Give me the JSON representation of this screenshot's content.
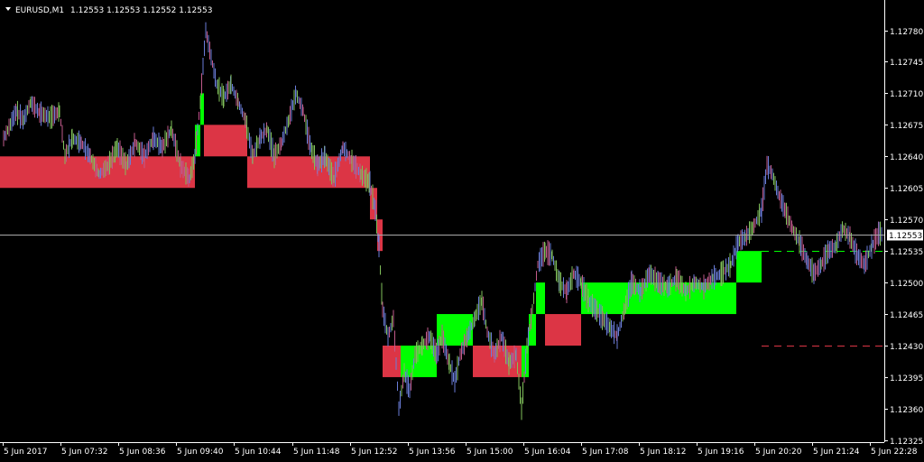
{
  "header": {
    "symbol": "EURUSD,M1",
    "ohlc": "1.12553 1.12553 1.12552 1.12553"
  },
  "colors": {
    "background": "#000000",
    "up_box": "#00ff00",
    "down_box": "#dc3545",
    "price_line": "#a9a9a9",
    "candle_a": "#6a7dd8",
    "candle_b": "#c05a8a",
    "candle_c": "#7fbf5a",
    "axis": "#ffffff"
  },
  "chart_data": {
    "type": "renko_overlay_price_chart",
    "x_tick_labels": [
      "5 Jun 2017",
      "5 Jun 07:32",
      "5 Jun 08:36",
      "5 Jun 09:40",
      "5 Jun 10:44",
      "5 Jun 11:48",
      "5 Jun 12:52",
      "5 Jun 13:56",
      "5 Jun 15:00",
      "5 Jun 16:04",
      "5 Jun 17:08",
      "5 Jun 18:12",
      "5 Jun 19:16",
      "5 Jun 20:20",
      "5 Jun 21:24",
      "5 Jun 22:28"
    ],
    "y_tick_labels": [
      "1.12780",
      "1.12745",
      "1.12710",
      "1.12675",
      "1.12640",
      "1.12605",
      "1.12570",
      "1.12535",
      "1.12500",
      "1.12465",
      "1.12430",
      "1.12395",
      "1.12360",
      "1.12325"
    ],
    "y_range": [
      1.1232,
      1.12795
    ],
    "current_price": "1.12553",
    "x_range": [
      0,
      980
    ],
    "boxes": [
      {
        "x0": 0,
        "x1": 216,
        "lo": 1.12605,
        "hi": 1.1264,
        "dir": "down"
      },
      {
        "x0": 216,
        "x1": 222,
        "lo": 1.1264,
        "hi": 1.12675,
        "dir": "up"
      },
      {
        "x0": 222,
        "x1": 226,
        "lo": 1.12675,
        "hi": 1.1271,
        "dir": "up"
      },
      {
        "x0": 226,
        "x1": 274,
        "lo": 1.1264,
        "hi": 1.12675,
        "dir": "down"
      },
      {
        "x0": 274,
        "x1": 410,
        "lo": 1.12605,
        "hi": 1.1264,
        "dir": "down"
      },
      {
        "x0": 410,
        "x1": 418,
        "lo": 1.1257,
        "hi": 1.12605,
        "dir": "down"
      },
      {
        "x0": 418,
        "x1": 424,
        "lo": 1.12535,
        "hi": 1.1257,
        "dir": "down"
      },
      {
        "x0": 424,
        "x1": 444,
        "lo": 1.12395,
        "hi": 1.1243,
        "dir": "down"
      },
      {
        "x0": 444,
        "x1": 484,
        "lo": 1.12395,
        "hi": 1.1243,
        "dir": "up"
      },
      {
        "x0": 484,
        "x1": 524,
        "lo": 1.1243,
        "hi": 1.12465,
        "dir": "up"
      },
      {
        "x0": 524,
        "x1": 578,
        "lo": 1.12395,
        "hi": 1.1243,
        "dir": "down"
      },
      {
        "x0": 578,
        "x1": 586,
        "lo": 1.12395,
        "hi": 1.1243,
        "dir": "up"
      },
      {
        "x0": 586,
        "x1": 594,
        "lo": 1.1243,
        "hi": 1.12465,
        "dir": "up"
      },
      {
        "x0": 594,
        "x1": 604,
        "lo": 1.12465,
        "hi": 1.125,
        "dir": "up"
      },
      {
        "x0": 604,
        "x1": 644,
        "lo": 1.1243,
        "hi": 1.12465,
        "dir": "down"
      },
      {
        "x0": 644,
        "x1": 816,
        "lo": 1.12465,
        "hi": 1.125,
        "dir": "up"
      },
      {
        "x0": 816,
        "x1": 844,
        "lo": 1.125,
        "hi": 1.12535,
        "dir": "up"
      }
    ],
    "dashed_lines": [
      {
        "x0": 844,
        "x1": 980,
        "price": 1.12535,
        "dir": "up"
      },
      {
        "x0": 844,
        "x1": 980,
        "price": 1.1243,
        "dir": "down"
      }
    ],
    "price_path": [
      [
        4,
        1.1266
      ],
      [
        10,
        1.12672
      ],
      [
        18,
        1.1269
      ],
      [
        26,
        1.1268
      ],
      [
        34,
        1.127
      ],
      [
        44,
        1.12688
      ],
      [
        56,
        1.12683
      ],
      [
        66,
        1.1269
      ],
      [
        72,
        1.1264
      ],
      [
        80,
        1.1266
      ],
      [
        90,
        1.12655
      ],
      [
        100,
        1.1264
      ],
      [
        110,
        1.1262
      ],
      [
        120,
        1.1263
      ],
      [
        130,
        1.1265
      ],
      [
        140,
        1.1263
      ],
      [
        150,
        1.12655
      ],
      [
        160,
        1.1264
      ],
      [
        170,
        1.1266
      ],
      [
        180,
        1.1265
      ],
      [
        190,
        1.1267
      ],
      [
        200,
        1.1263
      ],
      [
        210,
        1.12615
      ],
      [
        216,
        1.1264
      ],
      [
        222,
        1.127
      ],
      [
        228,
        1.1278
      ],
      [
        234,
        1.1275
      ],
      [
        240,
        1.1272
      ],
      [
        248,
        1.12705
      ],
      [
        256,
        1.1272
      ],
      [
        264,
        1.127
      ],
      [
        272,
        1.1268
      ],
      [
        280,
        1.1264
      ],
      [
        288,
        1.1266
      ],
      [
        296,
        1.1267
      ],
      [
        304,
        1.1264
      ],
      [
        312,
        1.12655
      ],
      [
        320,
        1.1268
      ],
      [
        328,
        1.1271
      ],
      [
        336,
        1.1269
      ],
      [
        344,
        1.1265
      ],
      [
        352,
        1.1263
      ],
      [
        360,
        1.1264
      ],
      [
        370,
        1.12615
      ],
      [
        380,
        1.1265
      ],
      [
        390,
        1.12635
      ],
      [
        400,
        1.1262
      ],
      [
        410,
        1.1261
      ],
      [
        416,
        1.1258
      ],
      [
        420,
        1.1254
      ],
      [
        424,
        1.1247
      ],
      [
        430,
        1.1244
      ],
      [
        436,
        1.1246
      ],
      [
        442,
        1.1236
      ],
      [
        448,
        1.124
      ],
      [
        454,
        1.1238
      ],
      [
        460,
        1.1242
      ],
      [
        468,
        1.1243
      ],
      [
        476,
        1.1244
      ],
      [
        484,
        1.1242
      ],
      [
        490,
        1.1244
      ],
      [
        498,
        1.1241
      ],
      [
        504,
        1.1239
      ],
      [
        510,
        1.1242
      ],
      [
        518,
        1.1244
      ],
      [
        526,
        1.1246
      ],
      [
        534,
        1.1248
      ],
      [
        540,
        1.12445
      ],
      [
        548,
        1.1242
      ],
      [
        556,
        1.1244
      ],
      [
        564,
        1.1241
      ],
      [
        572,
        1.1242
      ],
      [
        578,
        1.1236
      ],
      [
        584,
        1.1243
      ],
      [
        590,
        1.1247
      ],
      [
        596,
        1.1252
      ],
      [
        604,
        1.12535
      ],
      [
        612,
        1.1253
      ],
      [
        620,
        1.125
      ],
      [
        628,
        1.1249
      ],
      [
        636,
        1.1251
      ],
      [
        644,
        1.125
      ],
      [
        652,
        1.1248
      ],
      [
        660,
        1.1247
      ],
      [
        668,
        1.1246
      ],
      [
        676,
        1.1245
      ],
      [
        684,
        1.1244
      ],
      [
        692,
        1.1247
      ],
      [
        700,
        1.125
      ],
      [
        710,
        1.1249
      ],
      [
        720,
        1.1251
      ],
      [
        730,
        1.125
      ],
      [
        740,
        1.12495
      ],
      [
        750,
        1.12505
      ],
      [
        760,
        1.1249
      ],
      [
        770,
        1.125
      ],
      [
        780,
        1.12495
      ],
      [
        790,
        1.12505
      ],
      [
        800,
        1.1251
      ],
      [
        810,
        1.1252
      ],
      [
        818,
        1.12545
      ],
      [
        826,
        1.1255
      ],
      [
        834,
        1.1256
      ],
      [
        844,
        1.1258
      ],
      [
        850,
        1.1263
      ],
      [
        856,
        1.1262
      ],
      [
        862,
        1.126
      ],
      [
        870,
        1.1258
      ],
      [
        878,
        1.1256
      ],
      [
        886,
        1.12545
      ],
      [
        894,
        1.12525
      ],
      [
        902,
        1.1251
      ],
      [
        910,
        1.1252
      ],
      [
        918,
        1.12535
      ],
      [
        926,
        1.1254
      ],
      [
        934,
        1.1256
      ],
      [
        942,
        1.1255
      ],
      [
        950,
        1.1253
      ],
      [
        958,
        1.1252
      ],
      [
        966,
        1.1254
      ],
      [
        974,
        1.12555
      ],
      [
        978,
        1.12553
      ]
    ]
  }
}
